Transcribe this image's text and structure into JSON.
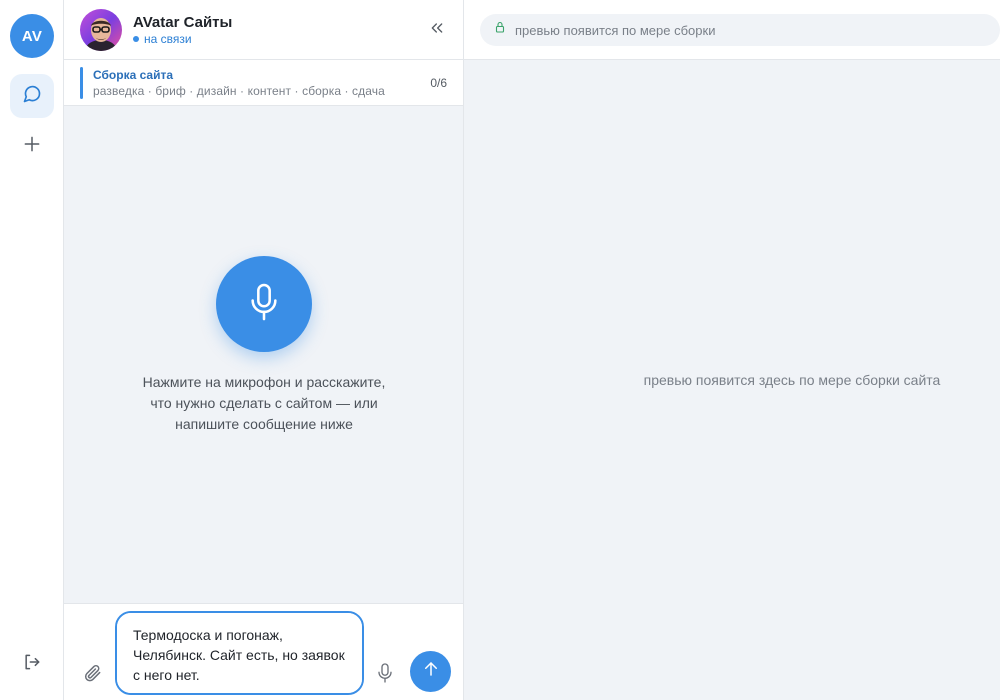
{
  "rail": {
    "avatar_initials": "AV"
  },
  "chat": {
    "agent_name": "AVatar Сайты",
    "agent_status": "на связи",
    "progress": {
      "title": "Сборка сайта",
      "steps_text": "разведка · бриф · дизайн · контент · сборка · сдача",
      "count": "0/6",
      "completed": 0,
      "total": 6
    },
    "hint": "Нажмите на микрофон и расскажите, что нужно сделать с сайтом — или напишите сообщение ниже",
    "input_value": "Термодоска и погонаж, Челябинск. Сайт есть, но заявок с него нет."
  },
  "preview": {
    "url_text": "превью появится по мере сборки",
    "placeholder": "превью появится здесь по мере сборки сайта"
  },
  "colors": {
    "accent": "#3a8ee6",
    "background": "#f0f3f7",
    "status": "#2b7fd4"
  },
  "icons": {
    "rail_chat": "chat-bubble-icon",
    "rail_add": "plus-icon",
    "rail_logout": "logout-icon",
    "collapse": "chevrons-left-icon",
    "lock": "lock-icon",
    "mic": "microphone-icon",
    "attach": "paperclip-icon",
    "send": "arrow-up-icon"
  }
}
